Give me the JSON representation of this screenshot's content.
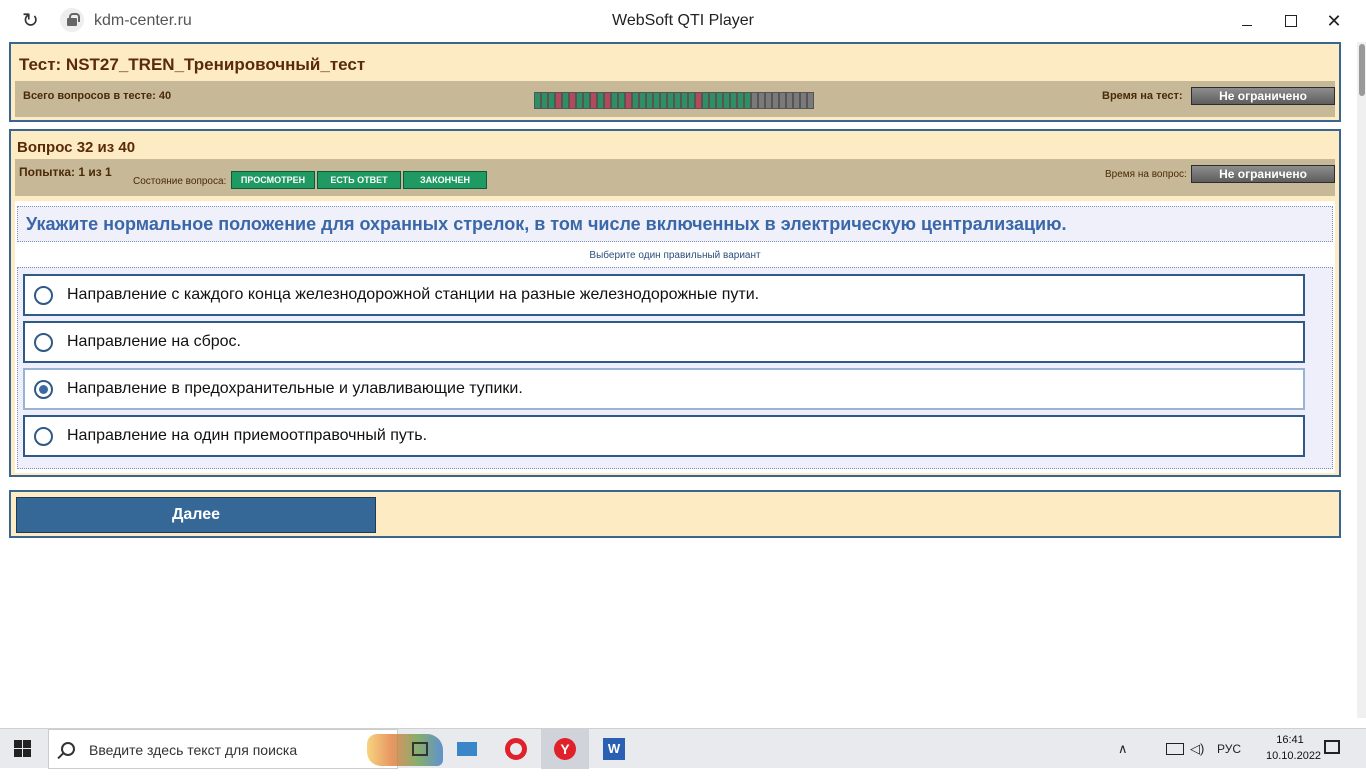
{
  "browser": {
    "url": "kdm-center.ru",
    "window_title": "WebSoft QTI Player",
    "minimize": "",
    "maximize": "",
    "close": "✕"
  },
  "test": {
    "title": "Тест: NST27_TREN_Тренировочный_тест",
    "total_label": "Всего вопросов в тесте: 40",
    "time_label": "Время на тест:",
    "time_value": "Не ограничено",
    "progress": [
      "g",
      "g",
      "g",
      "r",
      "g",
      "r",
      "g",
      "g",
      "r",
      "g",
      "r",
      "g",
      "g",
      "r",
      "g",
      "g",
      "g",
      "g",
      "g",
      "g",
      "g",
      "g",
      "g",
      "r",
      "g",
      "g",
      "g",
      "g",
      "g",
      "g",
      "g",
      "e",
      "e",
      "e",
      "e",
      "e",
      "e",
      "e",
      "e",
      "e"
    ]
  },
  "question": {
    "counter": "Вопрос 32 из 40",
    "attempt": "Попытка: 1 из 1",
    "state_label": "Состояние вопроса:",
    "states": [
      "ПРОСМОТРЕН",
      "ЕСТЬ ОТВЕТ",
      "ЗАКОНЧЕН"
    ],
    "time_label": "Время на вопрос:",
    "time_value": "Не ограничено",
    "text": "Укажите нормальное положение для охранных стрелок, в том числе включенных в электрическую централизацию.",
    "hint": "Выберите один правильный вариант",
    "answers": [
      {
        "text": "Направление с каждого конца железнодорожной станции на разные железнодорожные пути.",
        "selected": false
      },
      {
        "text": "Направление на сброс.",
        "selected": false
      },
      {
        "text": "Направление в предохранительные и улавливающие тупики.",
        "selected": true
      },
      {
        "text": "Направление на один приемоотправочный путь.",
        "selected": false
      }
    ]
  },
  "actions": {
    "next": "Далее"
  },
  "taskbar": {
    "search_placeholder": "Введите здесь текст для поиска",
    "language": "РУС",
    "time": "16:41",
    "date": "10.10.2022"
  }
}
